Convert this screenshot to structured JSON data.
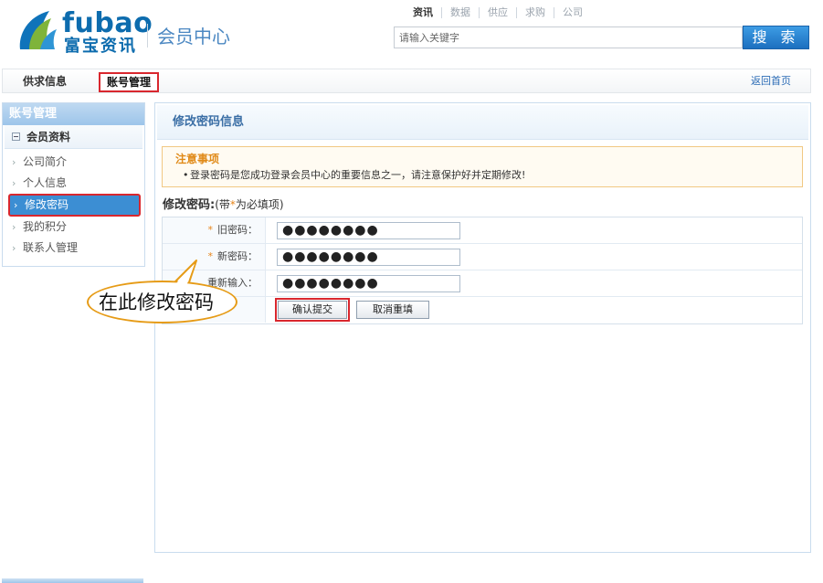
{
  "header": {
    "logo_text": "fubao",
    "logo_subtext": "富宝资讯",
    "member_center": "会员中心",
    "search_tabs": [
      "资讯",
      "数据",
      "供应",
      "求购",
      "公司"
    ],
    "active_search_tab": "资讯",
    "search_placeholder": "请输入关键字",
    "search_button": "搜 索"
  },
  "nav": {
    "items": [
      "供求信息",
      "账号管理"
    ],
    "active_item": "账号管理",
    "home_link": "返回首页"
  },
  "sidebar": {
    "title": "账号管理",
    "group": "会员资料",
    "items": [
      "公司简介",
      "个人信息",
      "修改密码",
      "我的积分",
      "联系人管理"
    ],
    "active_item": "修改密码"
  },
  "callout": {
    "text": "在此修改密码"
  },
  "main": {
    "title": "修改密码信息",
    "notice": {
      "title": "注意事项",
      "text": "登录密码是您成功登录会员中心的重要信息之一，请注意保护好并定期修改!"
    },
    "form_title": "修改密码:",
    "form_hint_prefix": "(带",
    "form_hint_star": "*",
    "form_hint_suffix": "为必填项)",
    "fields": [
      {
        "label": "旧密码：",
        "required": true,
        "value": "●●●●●●●●"
      },
      {
        "label": "新密码：",
        "required": true,
        "value": "●●●●●●●●"
      },
      {
        "label": "重新输入：",
        "required": false,
        "value": "●●●●●●●●"
      }
    ],
    "submit_button": "确认提交",
    "reset_button": "取消重填"
  },
  "colors": {
    "brand_blue": "#0d6cae",
    "accent_blue": "#3c8ed3",
    "highlight_red": "#d9272e",
    "notice_orange": "#e08a18",
    "callout_orange": "#e69b16"
  },
  "icons": [
    "fubao-logo-icon",
    "search-icon",
    "chevron-right-icon",
    "minus-icon"
  ]
}
